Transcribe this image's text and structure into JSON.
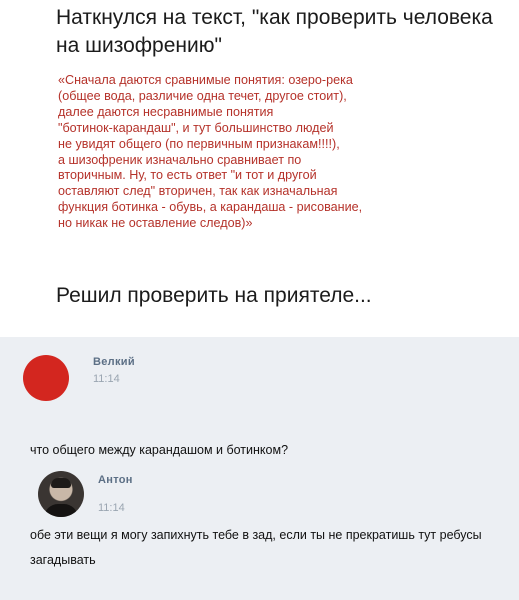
{
  "meme": {
    "heading": "Наткнулся на  текст, \"как проверить человека на шизофрению\"",
    "quote": "«Сначала даются сравнимые понятия: озеро-река\n(общее вода, различие одна течет, другое стоит),\nдалее даются несравнимые понятия\n\"ботинок-карандаш\", и тут большинство людей\nне увидят общего (по первичным признакам!!!!),\nа шизофреник изначально сравнивает по\nвторичным. Ну, то есть ответ \"и тот и другой\nоставляют след\" вторичен, так как изначальная\nфункция ботинка - обувь, а карандаша - рисование,\nно никак не оставление следов)»",
    "subheading": "Решил проверить на приятеле..."
  },
  "chat": {
    "messages": [
      {
        "author": "Велкий",
        "time": "11:14",
        "text": "что общего между карандашом и ботинком?",
        "avatar_color": "#d3261f"
      },
      {
        "author": "Антон",
        "time": "11:14",
        "text": "обе эти вещи я могу запихнуть тебе в зад, если ты не прекратишь тут ребусы загадывать",
        "avatar_icon": "profile-photo"
      }
    ]
  },
  "colors": {
    "quote_text": "#b5322a",
    "chat_background": "#eceff3",
    "author_name": "#5c6f85"
  }
}
